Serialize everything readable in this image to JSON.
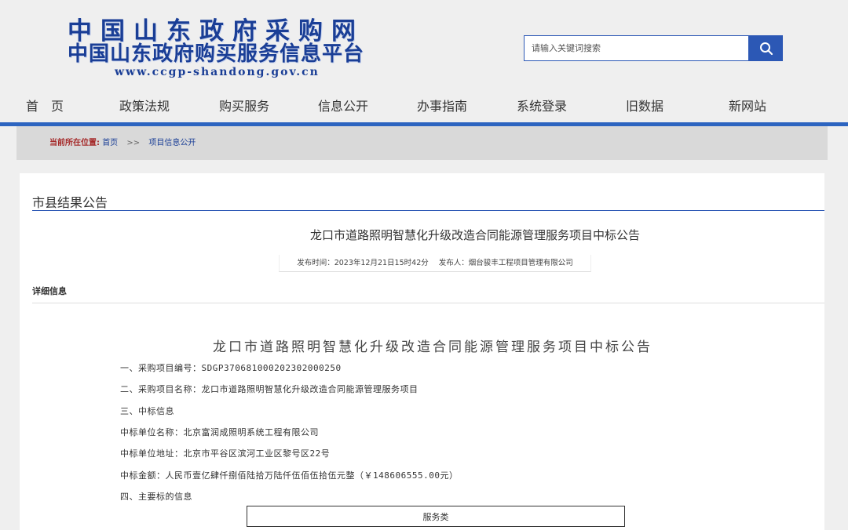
{
  "header": {
    "logo_line1": "中国山东政府采购网",
    "logo_line2": "中国山东政府购买服务信息平台",
    "logo_url_text": "www.ccgp-shandong.gov.cn",
    "search_placeholder": "请输入关键词搜索",
    "search_icon": "search-icon"
  },
  "nav": {
    "items": [
      "首　页",
      "政策法规",
      "购买服务",
      "信息公开",
      "办事指南",
      "系统登录",
      "旧数据",
      "新网站"
    ]
  },
  "breadcrumb": {
    "label": "当前所在位置:",
    "home": "首页",
    "separator": ">>",
    "current": "项目信息公开"
  },
  "section": {
    "title": "市县结果公告"
  },
  "article": {
    "title": "龙口市道路照明智慧化升级改造合同能源管理服务项目中标公告",
    "publish_time": "发布时间：2023年12月21日15时42分",
    "publisher": "发布人：烟台骏丰工程项目管理有限公司",
    "detail_label": "详细信息"
  },
  "doc": {
    "title": "龙口市道路照明智慧化升级改造合同能源管理服务项目中标公告",
    "lines": [
      "一、采购项目编号：SDGP370681000202302000250",
      "二、采购项目名称：龙口市道路照明智慧化升级改造合同能源管理服务项目",
      "三、中标信息",
      "中标单位名称：北京富润成照明系统工程有限公司",
      "中标单位地址：北京市平谷区滨河工业区黎号区22号",
      "中标金额：人民币壹亿肆仟捌佰陆拾万陆仟伍佰伍拾伍元整（￥148606555.00元）",
      "四、主要标的信息"
    ],
    "table_header": "服务类"
  },
  "colors": {
    "brand_blue": "#1a3e96",
    "nav_bar": "#2c64c0",
    "crumb_label": "#a52a2a"
  }
}
